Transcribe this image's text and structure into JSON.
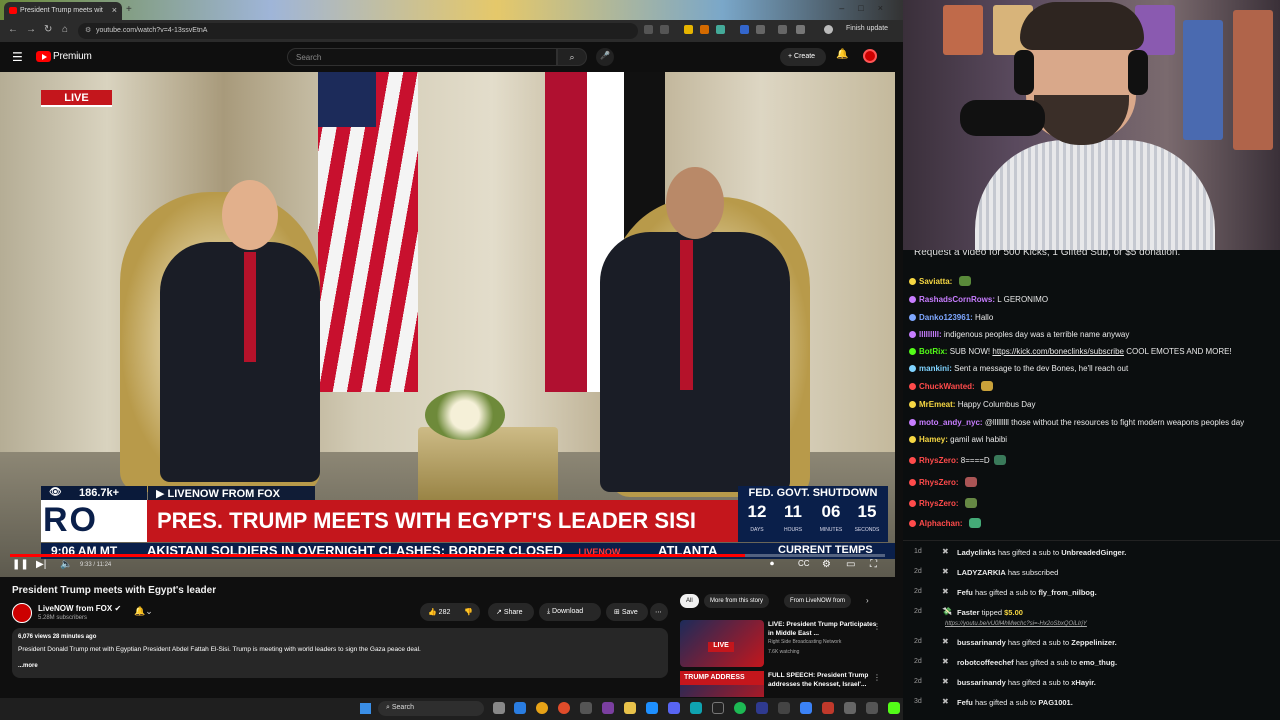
{
  "browser": {
    "tab_title": "President Trump meets wit",
    "url": "youtube.com/watch?v=4-13ssvEtnA",
    "finish_update": "Finish update"
  },
  "youtube": {
    "brand": "Premium",
    "search_placeholder": "Search",
    "create_label": "Create"
  },
  "video": {
    "live_badge": "LIVE",
    "viewers": "186.7k+",
    "source": "LIVENOW FROM FOX",
    "shutdown_label": "FED. GOVT. SHUTDOWN",
    "headline": "PRES. TRUMP MEETS WITH EGYPT'S LEADER SISI",
    "network_mark": "RO",
    "countdown": [
      {
        "value": "12",
        "label": "DAYS"
      },
      {
        "value": "11",
        "label": "HOURS"
      },
      {
        "value": "06",
        "label": "MINUTES"
      },
      {
        "value": "15",
        "label": "SECONDS"
      }
    ],
    "clock": "9:06 AM MT",
    "crawl": "AKISTANI SOLDIERS IN OVERNIGHT CLASHES; BORDER CLOSED",
    "crawl_tag": "LIVENOW",
    "crawl_city": "ATLANTA",
    "temps_label": "CURRENT TEMPS",
    "timecode": "9:33 / 11:24",
    "progress": 0.84
  },
  "details": {
    "title": "President Trump meets with Egypt's leader",
    "channel": "LiveNOW from FOX",
    "subscribers": "5.28M subscribers",
    "likes": "282",
    "share_label": "Share",
    "download_label": "Download",
    "save_label": "Save",
    "meta": "6,076 views  28 minutes ago",
    "description": "President Donald Trump met with Egyptian President Abdel Fattah El-Sisi. Trump is meeting with world leaders to sign the Gaza peace deal.",
    "more_label": "...more"
  },
  "related": {
    "chips": [
      "All",
      "More from this story",
      "From LiveNOW from"
    ],
    "items": [
      {
        "title": "LIVE: President Trump Participates in Middle East ...",
        "channel": "Right Side Broadcasting Network",
        "views": "7.6K watching",
        "badge": "LIVE",
        "thumb_label": ""
      },
      {
        "title": "FULL SPEECH: President Trump addresses the Knesset, Israel'...",
        "channel": "",
        "views": "",
        "badge": "",
        "thumb_label": "TRUMP ADDRESS"
      }
    ]
  },
  "taskbar": {
    "search_label": "Search"
  },
  "chat": {
    "pinned": "Request a video for 500 Kicks, 1 Gifted Sub, or $5 donation.",
    "messages": [
      {
        "user": "Saviatta:",
        "text": "",
        "color": "#f6d743"
      },
      {
        "user": "RashadsCornRows:",
        "text": "L GERONIMO",
        "color": "#c77dff"
      },
      {
        "user": "Danko123961:",
        "text": "Hallo",
        "color": "#7ea7ff"
      },
      {
        "user": "lllllllll:",
        "text": "indigenous peoples day was a terrible name anyway",
        "color": "#c77dff"
      },
      {
        "user": "BotRix:",
        "text": "SUB NOW!",
        "link": "https://kick.com/boneclinks/subscribe",
        "tail": "COOL EMOTES AND MORE!",
        "color": "#53fc18"
      },
      {
        "user": "mankini:",
        "text": "Sent a message to the dev Bones, he'll reach out",
        "color": "#7fd3ff"
      },
      {
        "user": "ChuckWanted:",
        "text": "",
        "color": "#ff4b4b"
      },
      {
        "user": "MrEmeat:",
        "text": "Happy Columbus Day",
        "color": "#f6d743"
      },
      {
        "user": "moto_andy_nyc:",
        "text": "@lllllllll those without the resources to fight modern weapons peoples day",
        "color": "#c77dff"
      },
      {
        "user": "Hamey:",
        "text": "gamil awi habibi",
        "color": "#f6d743"
      },
      {
        "user": "RhysZero:",
        "text": "8====D",
        "color": "#ff4b4b"
      },
      {
        "user": "RhysZero:",
        "text": "",
        "color": "#ff4b4b"
      },
      {
        "user": "RhysZero:",
        "text": "",
        "color": "#ff4b4b"
      },
      {
        "user": "Alphachan:",
        "text": "",
        "color": "#ff4b4b"
      }
    ]
  },
  "events": [
    {
      "ago": "1d",
      "user": "Ladyclinks",
      "text": "has gifted a sub to",
      "target": "UnbreadedGinger."
    },
    {
      "ago": "2d",
      "user": "LADYZARKIA",
      "text": "has subscribed",
      "target": ""
    },
    {
      "ago": "2d",
      "user": "Fefu",
      "text": "has gifted a sub to",
      "target": "fly_from_nilbog."
    },
    {
      "ago": "2d",
      "user": "Faster",
      "text": "tipped",
      "target": "$5.00"
    },
    {
      "ago": "2d",
      "user": "bussarinandy",
      "text": "has gifted a sub to",
      "target": "Zeppelinizer."
    },
    {
      "ago": "2d",
      "user": "robotcoffeechef",
      "text": "has gifted a sub to",
      "target": "emo_thug."
    },
    {
      "ago": "2d",
      "user": "bussarinandy",
      "text": "has gifted a sub to",
      "target": "xHayir."
    },
    {
      "ago": "3d",
      "user": "Fefu",
      "text": "has gifted a sub to",
      "target": "PAG1001."
    }
  ],
  "tip_url": "https://youtu.be/vU0ll4hMwchc?si=-Hx2oSbxQOiLIrjY",
  "colors": {
    "accent": "#ff0000",
    "fox_red": "#c4161c",
    "fox_navy": "#0a1f4a",
    "kick_green": "#53fc18"
  }
}
